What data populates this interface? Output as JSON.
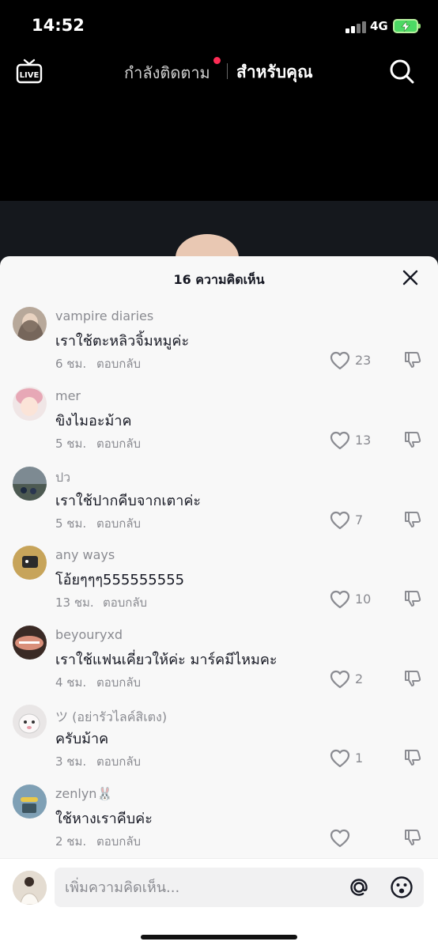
{
  "status_bar": {
    "time": "14:52",
    "network": "4G"
  },
  "top_nav": {
    "live_label": "LIVE",
    "following_tab": "กำลังติดตาม",
    "for_you_tab": "สำหรับคุณ"
  },
  "sheet": {
    "title": "16 ความคิดเห็น",
    "comments": [
      {
        "user": "vampire diaries",
        "text": "เราใช้ตะหลิวจิ้มหมูค่ะ",
        "time": "6 ชม.",
        "reply": "ตอบกลับ",
        "likes": "23"
      },
      {
        "user": "mer",
        "text": "ขิงไมอะม้าค",
        "time": "5 ชม.",
        "reply": "ตอบกลับ",
        "likes": "13"
      },
      {
        "user": "ปว",
        "text": "เราใช้ปากคีบจากเตาค่ะ",
        "time": "5 ชม.",
        "reply": "ตอบกลับ",
        "likes": "7"
      },
      {
        "user": "any ways",
        "text": "โอ้ยๆๆๆ555555555",
        "time": "13 ชม.",
        "reply": "ตอบกลับ",
        "likes": "10"
      },
      {
        "user": "beyouryxd",
        "text": "เราใช้แฟนเคี่ยวให้ค่ะ มาร์คมีไหมคะ",
        "time": "4 ชม.",
        "reply": "ตอบกลับ",
        "likes": "2"
      },
      {
        "user": "ツ (อย่ารัวไลค์สิเตง)",
        "text": "ครับม้าค",
        "time": "3 ชม.",
        "reply": "ตอบกลับ",
        "likes": "1"
      },
      {
        "user": "zenlyn🐰",
        "text": "ใช้หางเราคีบค่ะ",
        "time": "2 ชม.",
        "reply": "ตอบกลับ",
        "likes": ""
      }
    ]
  },
  "composer": {
    "placeholder": "เพิ่มความคิดเห็น..."
  },
  "colors": {
    "accent": "#fe2c55",
    "sheet_bg": "#f8f8f8",
    "secondary_text": "#8a8b91"
  }
}
